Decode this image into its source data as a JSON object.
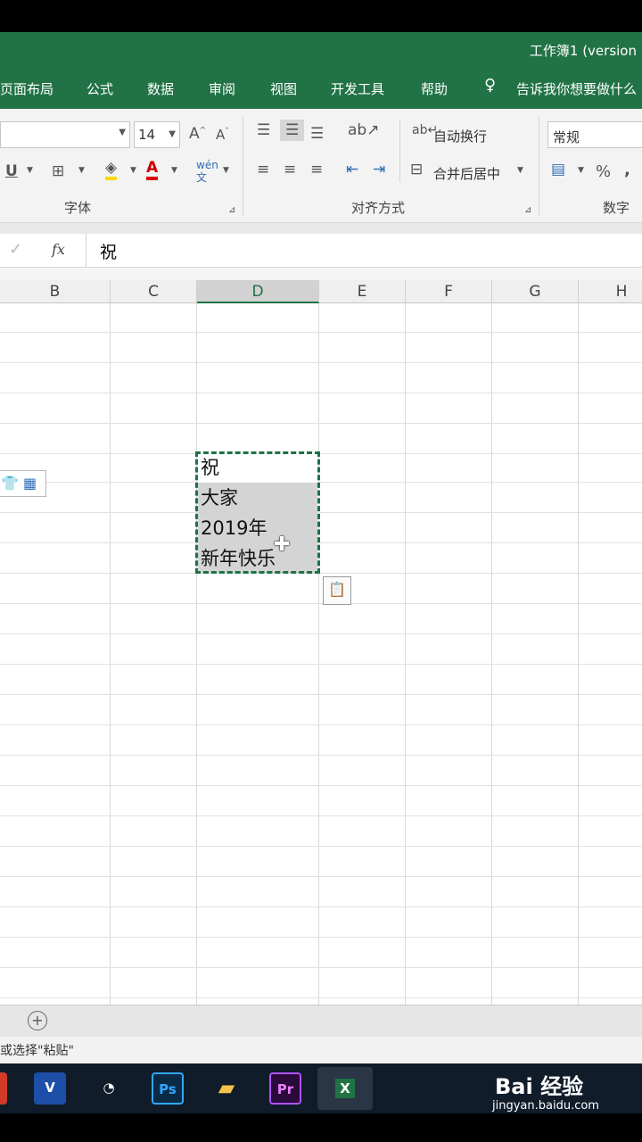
{
  "window": {
    "title": "工作簿1 (version"
  },
  "menu": {
    "items": [
      "页面布局",
      "公式",
      "数据",
      "审阅",
      "视图",
      "开发工具",
      "帮助"
    ],
    "tell_me": "告诉我你想要做什么"
  },
  "ribbon": {
    "font_size": "14",
    "font_group_label": "字体",
    "align_group_label": "对齐方式",
    "number_group_label": "数字",
    "wrap_text_label": "自动换行",
    "merge_center_label": "合并后居中",
    "number_format": "常规",
    "percent_symbol": "%",
    "comma_symbol": ","
  },
  "formula_bar": {
    "fx_label": "fx",
    "value": "祝"
  },
  "columns": [
    "B",
    "C",
    "D",
    "E",
    "F",
    "G",
    "H"
  ],
  "cells": {
    "d_row1": "祝",
    "d_row2": "大家",
    "d_row3": "2019年",
    "d_row4": "新年快乐"
  },
  "status": {
    "message": "或选择\"粘贴\""
  },
  "watermark": {
    "brand": "Bai 经验",
    "url": "jingyan.baidu.com"
  },
  "colors": {
    "excel_green": "#217346",
    "selection_dash": "#1e7145",
    "selected_fill": "#d4d4d4"
  }
}
